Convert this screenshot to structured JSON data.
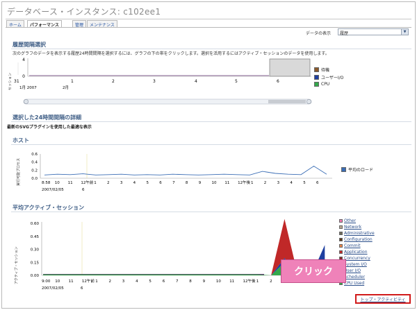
{
  "header": {
    "title": "データベース・インスタンス: c102ee1",
    "tabs": [
      {
        "label": "ホーム"
      },
      {
        "label": "パフォーマンス"
      },
      {
        "label": "管理"
      },
      {
        "label": "メンテナンス"
      }
    ]
  },
  "data_view": {
    "label": "データの表示",
    "selected": "履歴"
  },
  "history_section": {
    "title": "履歴間隔選択",
    "description": "次のグラフのデータを表示する履歴24時間間隔を選択するには、グラフの下の帯をクリックします。選択を活用するにはアクティブ・セッションのデータを使用します。",
    "y_label": "セッション",
    "y_ticks": [
      "4",
      "0"
    ],
    "x_ticks": [
      "31",
      "1",
      "2",
      "3",
      "4",
      "5",
      "6"
    ],
    "date_labels": [
      "1月 2007",
      "2月"
    ],
    "legend": [
      {
        "label": "待機",
        "color": "#8b5a2b"
      },
      {
        "label": "ユーザーI/O",
        "color": "#1f3fa0"
      },
      {
        "label": "CPU",
        "color": "#34a84b"
      }
    ]
  },
  "detail_section": {
    "title": "選択した24時間間隔の詳細",
    "subtitle": "最新のSVGプラグインを使用した最適な表示"
  },
  "host_chart": {
    "title": "ホスト",
    "y_label": "実行可能プロセス",
    "legend": "平均のロード",
    "y_ticks": [
      "0.6",
      "0.4",
      "0.2",
      "0.0"
    ],
    "x_ticks": [
      "8:58",
      "10",
      "11",
      "12午前",
      "1",
      "2",
      "3",
      "4",
      "5",
      "6",
      "7",
      "8",
      "9",
      "10",
      "11",
      "12午後",
      "1",
      "2",
      "3",
      "4",
      "5",
      "6"
    ],
    "date_label": "2007/02/05",
    "date_day": "6"
  },
  "sessions_chart": {
    "title": "平均アクティブ・セッション",
    "y_label": "アクティブ・セッション",
    "y_ticks": [
      "0.60",
      "0.45",
      "0.30",
      "0.15",
      "0.00"
    ],
    "x_ticks": [
      "9:00",
      "10",
      "11",
      "12午前",
      "1",
      "2",
      "3",
      "4",
      "5",
      "6",
      "7",
      "8",
      "9",
      "10",
      "11",
      "12午後",
      "1",
      "2",
      "3"
    ],
    "date_label": "2007/02/05",
    "date_day": "6",
    "legend": [
      {
        "label": "Other",
        "color": "#f07ab0"
      },
      {
        "label": "Network",
        "color": "#b8a890"
      },
      {
        "label": "Administrative",
        "color": "#6e6a5a"
      },
      {
        "label": "Configuration",
        "color": "#5c3a1c"
      },
      {
        "label": "Commit",
        "color": "#e8844a"
      },
      {
        "label": "Application",
        "color": "#c02828"
      },
      {
        "label": "Concurrency",
        "color": "#8a2a2a"
      },
      {
        "label": "System I/O",
        "color": "#5a7cc8"
      },
      {
        "label": "User I/O",
        "color": "#1f3fa0"
      },
      {
        "label": "Scheduler",
        "color": "#8ae08a"
      },
      {
        "label": "CPU Used",
        "color": "#34a84b"
      }
    ]
  },
  "callout": "クリック",
  "top_activity_link": "トップ・アクティビティ",
  "chart_data": [
    {
      "type": "line",
      "title": "ホスト",
      "ylabel": "実行可能プロセス",
      "ylim": [
        0,
        0.6
      ],
      "series": [
        {
          "name": "平均のロード",
          "values": [
            0.08,
            0.1,
            0.09,
            0.11,
            0.08,
            0.09,
            0.1,
            0.08,
            0.09,
            0.08,
            0.1,
            0.09,
            0.08,
            0.09,
            0.1,
            0.09,
            0.08,
            0.17,
            0.12,
            0.1,
            0.09,
            0.3,
            0.1
          ]
        }
      ]
    },
    {
      "type": "area",
      "title": "平均アクティブ・セッション",
      "ylabel": "アクティブ・セッション",
      "ylim": [
        0,
        0.6
      ],
      "series": [
        {
          "name": "CPU Used",
          "values": [
            0.01,
            0.01,
            0.01,
            0.01,
            0.01,
            0.01,
            0.01,
            0.01,
            0.01,
            0.01,
            0.01,
            0.01,
            0.01,
            0.01,
            0.01,
            0.01,
            0.01,
            0.0,
            0.15,
            0.0,
            0.0,
            0.05
          ]
        },
        {
          "name": "User I/O",
          "values": [
            0,
            0,
            0,
            0,
            0,
            0,
            0,
            0,
            0,
            0,
            0,
            0,
            0,
            0,
            0,
            0,
            0,
            0.0,
            0.05,
            0.0,
            0.0,
            0.3
          ]
        },
        {
          "name": "Application",
          "values": [
            0,
            0,
            0,
            0,
            0,
            0,
            0,
            0,
            0,
            0,
            0,
            0,
            0,
            0,
            0,
            0,
            0,
            0.0,
            0.45,
            0.0,
            0.0,
            0.0
          ]
        }
      ]
    }
  ]
}
